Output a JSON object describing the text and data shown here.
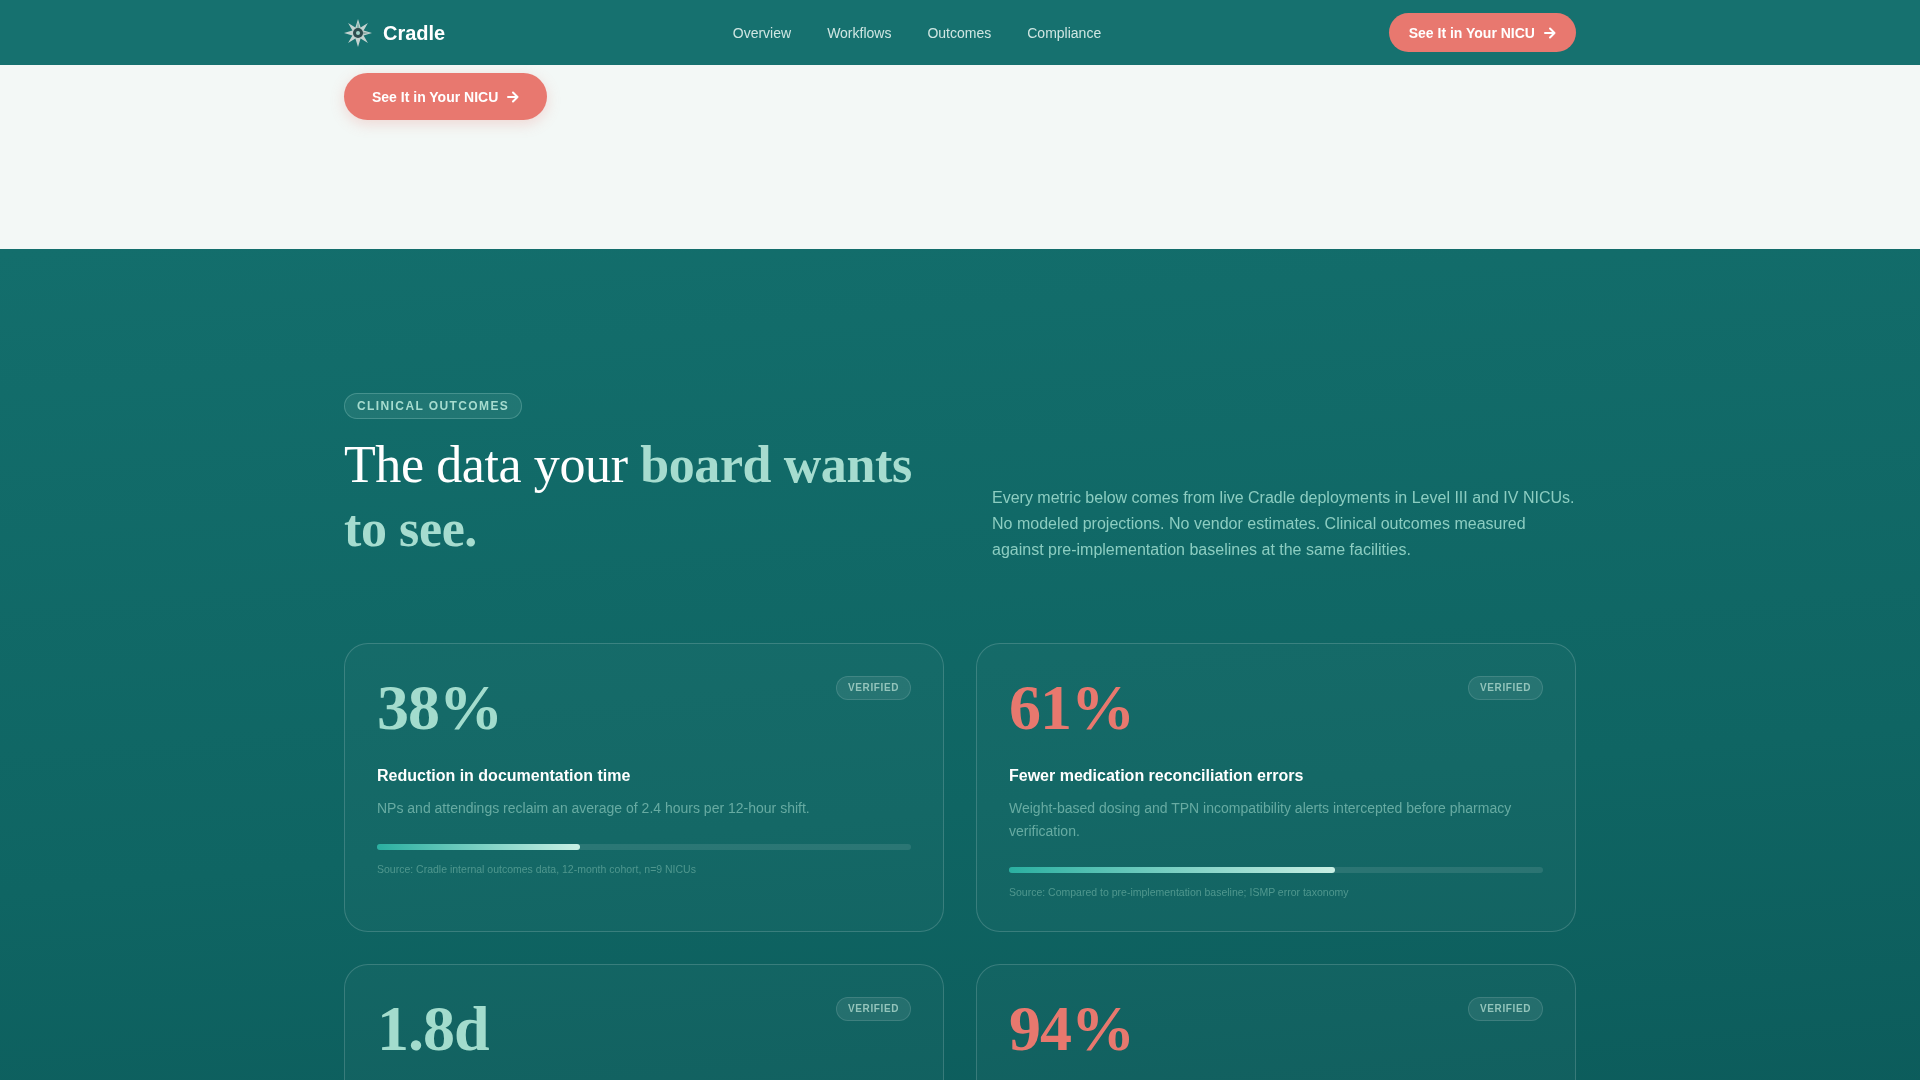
{
  "nav": {
    "brand": "Cradle",
    "links": [
      "Overview",
      "Workflows",
      "Outcomes",
      "Compliance"
    ],
    "cta": "See It in Your NICU"
  },
  "hero": {
    "cta": "See It in Your NICU"
  },
  "outcomes": {
    "eyebrow": "CLINICAL OUTCOMES",
    "heading": "The data your **board wants to see.**",
    "intro": "Every metric below comes from live Cradle deployments in Level III and IV NICUs. No modeled projections. No vendor estimates. Clinical outcomes measured against pre-implementation baselines at the same facilities.",
    "cards": [
      {
        "value": "38%",
        "color": "#a3dccd",
        "badge": "VERIFIED",
        "title": "Reduction in documentation time",
        "description": "NPs and attendings reclaim an average of 2.4 hours per 12-hour shift.",
        "level": 0.38,
        "source": "Source: Cradle internal outcomes data, 12-month cohort, n=9 NICUs"
      },
      {
        "value": "61%",
        "color": "#e8786e",
        "badge": "VERIFIED",
        "title": "Fewer medication reconciliation errors",
        "description": "Weight-based dosing and TPN incompatibility alerts intercepted before pharmacy verification.",
        "level": 0.61,
        "source": "Source: Compared to pre-implementation baseline; ISMP error taxonomy"
      },
      {
        "value": "1.8d",
        "color": "#a3dccd",
        "badge": "VERIFIED"
      },
      {
        "value": "94%",
        "color": "#e8786e",
        "badge": "VERIFIED"
      }
    ]
  }
}
